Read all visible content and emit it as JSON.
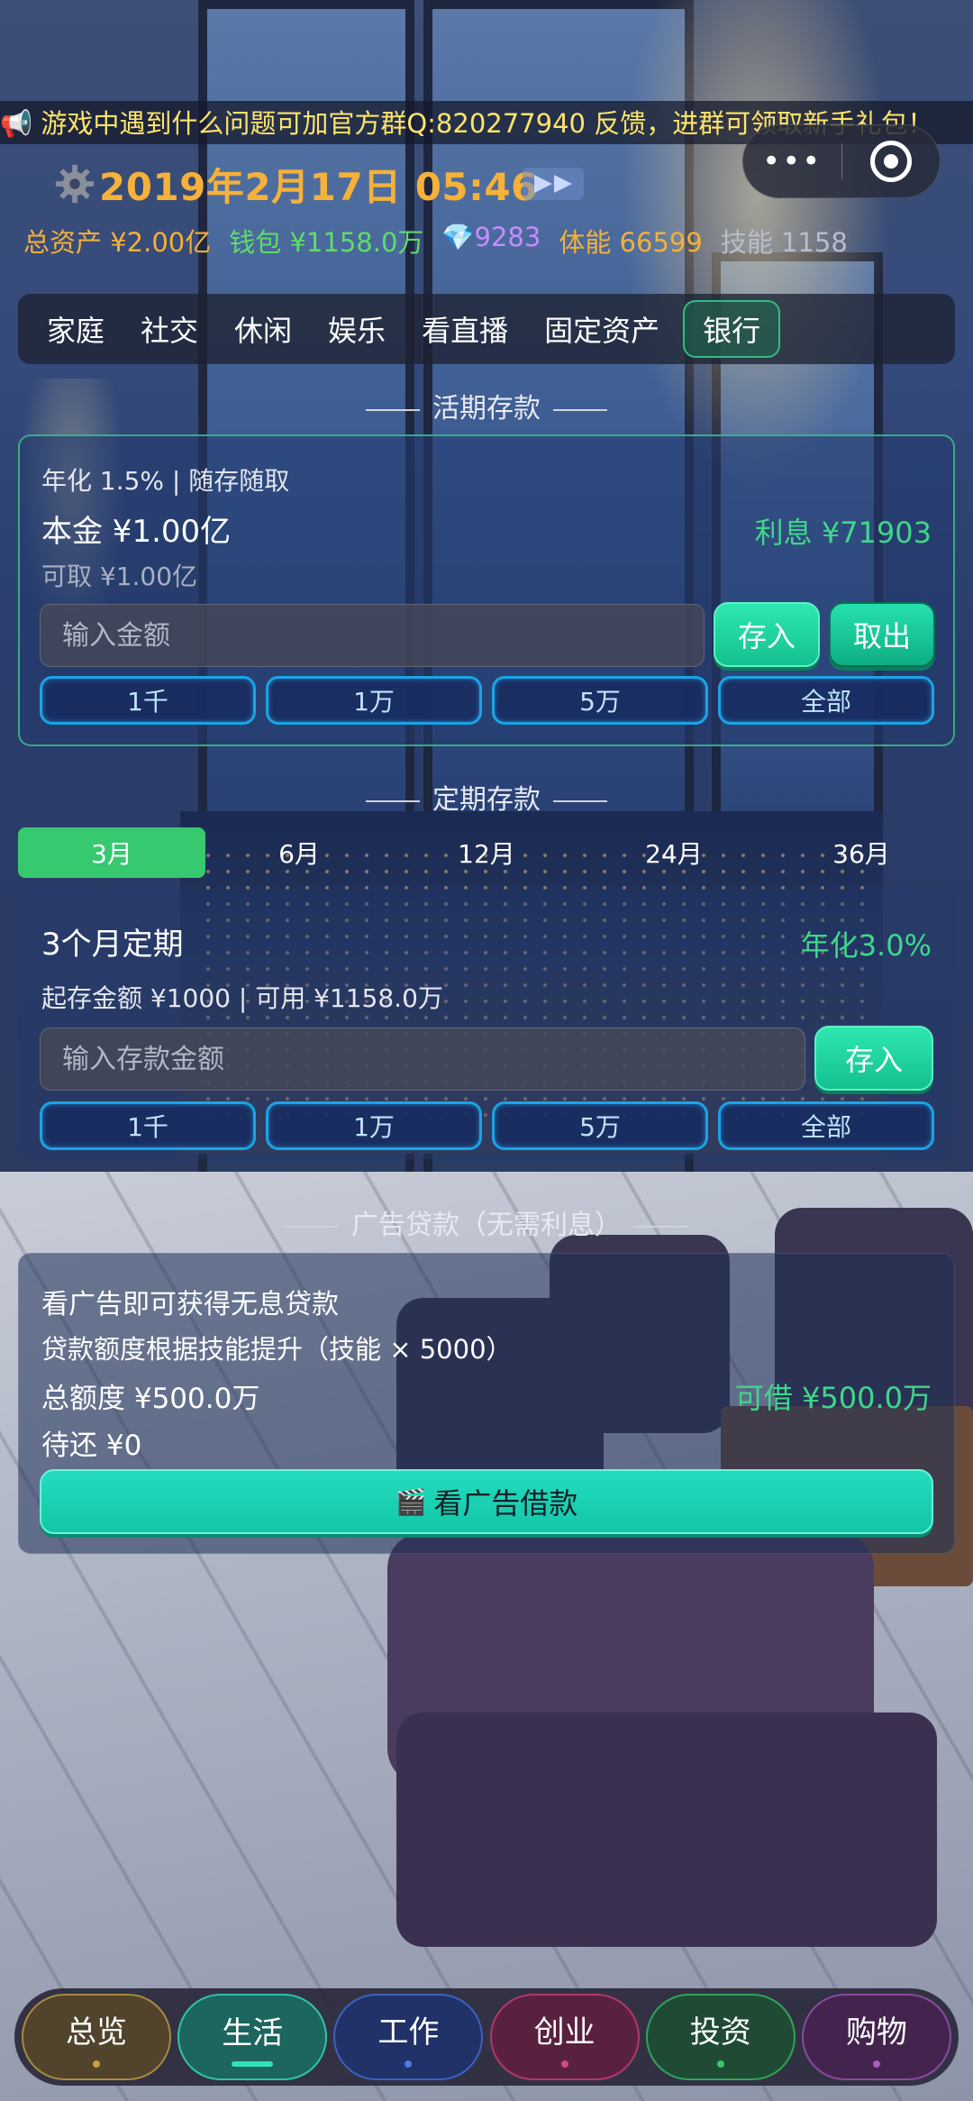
{
  "announcement": "📢 游戏中遇到什么问题可加官方群Q:820277940 反馈，进群可领取新手礼包！",
  "header": {
    "date": "2019年2月17日 05:46"
  },
  "stats": {
    "total_assets": "总资产 ¥2.00亿",
    "wallet": "钱包 ¥1158.0万",
    "diamonds": "💎9283",
    "stamina": "体能 66599",
    "skill": "技能 1158"
  },
  "tabs": [
    "家庭",
    "社交",
    "休闲",
    "娱乐",
    "看直播",
    "固定资产",
    "银行"
  ],
  "demand_deposit": {
    "title": "活期存款",
    "rate_info": "年化 1.5% | 随存随取",
    "principal": "本金 ¥1.00亿",
    "interest": "利息 ¥71903",
    "withdrawable": "可取 ¥1.00亿",
    "input_placeholder": "输入金额",
    "deposit_label": "存入",
    "withdraw_label": "取出",
    "chips": [
      "1千",
      "1万",
      "5万",
      "全部"
    ]
  },
  "fixed_deposit": {
    "title": "定期存款",
    "periods": [
      "3月",
      "6月",
      "12月",
      "24月",
      "36月"
    ],
    "selected_period": "3月",
    "plan_name": "3个月定期",
    "rate": "年化3.0%",
    "info": "起存金额 ¥1000 | 可用 ¥1158.0万",
    "input_placeholder": "输入存款金额",
    "deposit_label": "存入",
    "chips": [
      "1千",
      "1万",
      "5万",
      "全部"
    ]
  },
  "ad_loan": {
    "title": "广告贷款（无需利息）",
    "line1": "看广告即可获得无息贷款",
    "line2": "贷款额度根据技能提升（技能 × 5000）",
    "total_limit": "总额度 ¥500.0万",
    "available": "可借 ¥500.0万",
    "pending": "待还 ¥0",
    "button_icon": "🎬",
    "button_label": "看广告借款"
  },
  "bottom_nav": [
    "总览",
    "生活",
    "工作",
    "创业",
    "投资",
    "购物"
  ],
  "colors": {
    "accent_green": "#37c970",
    "gold": "#f3b03b",
    "chip_border": "#19a4e6"
  }
}
